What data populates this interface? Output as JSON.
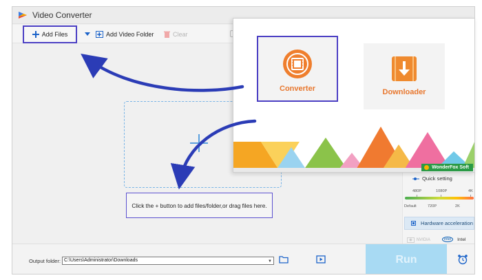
{
  "app": {
    "title": "Video Converter"
  },
  "toolbar": {
    "add_files_label": "Add Files",
    "add_folder_label": "Add Video Folder",
    "clear_label": "Clear"
  },
  "main": {
    "hint_text": "Click the + button to add files/folder,or drag files here."
  },
  "settings": {
    "quick_setting_label": "Quick setting",
    "quality_top": [
      "480P",
      "1080P",
      "4K"
    ],
    "quality_bottom": [
      "Default",
      "720P",
      "2K"
    ],
    "hardware_accel_label": "Hardware acceleration",
    "nvidia_label": "NVIDIA",
    "intel_label": "Intel"
  },
  "bottom": {
    "output_label": "Output folder:",
    "output_path": "C:\\Users\\Administrator\\Downloads",
    "run_label": "Run"
  },
  "popup": {
    "converter_label": "Converter",
    "downloader_label": "Downloader",
    "brand_label": "WonderFox Soft"
  },
  "colors": {
    "accent_orange": "#e8772e",
    "highlight_border": "#4b3fc4",
    "run_button": "#a8daf3",
    "arrow_blue": "#2b3cb6"
  }
}
